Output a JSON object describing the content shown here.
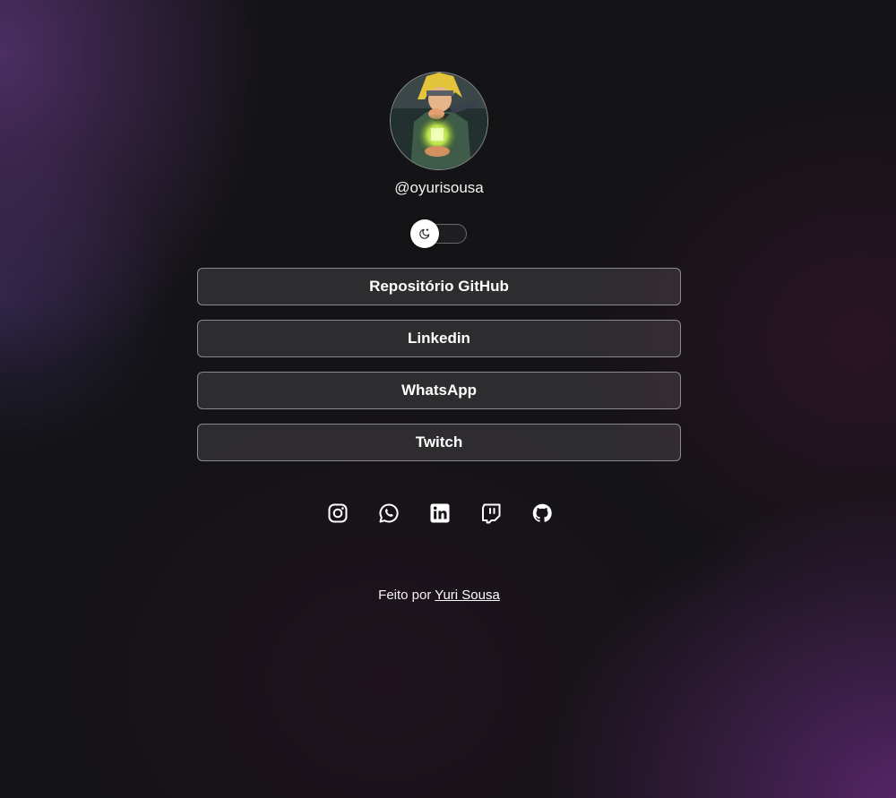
{
  "profile": {
    "username": "@oyurisousa"
  },
  "theme_toggle": {
    "icon": "moon-icon"
  },
  "links": [
    {
      "label": "Repositório GitHub"
    },
    {
      "label": "Linkedin"
    },
    {
      "label": "WhatsApp"
    },
    {
      "label": "Twitch"
    }
  ],
  "socials": [
    {
      "icon": "instagram-icon"
    },
    {
      "icon": "whatsapp-icon"
    },
    {
      "icon": "linkedin-icon"
    },
    {
      "icon": "twitch-icon"
    },
    {
      "icon": "github-icon"
    }
  ],
  "footer": {
    "prefix": "Feito por",
    "author": "Yuri Sousa"
  },
  "colors": {
    "background": "#141316",
    "accent_purple": "#5f377d",
    "button_border": "#8a8a8e",
    "text": "#ffffff"
  }
}
